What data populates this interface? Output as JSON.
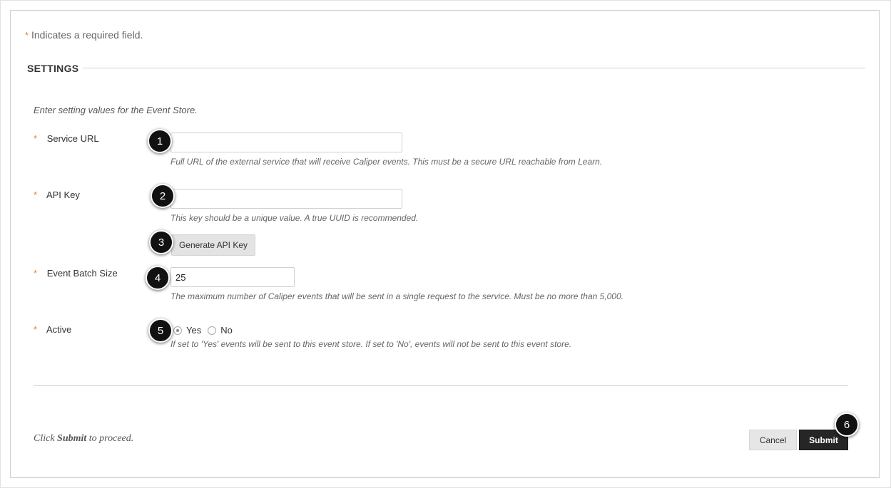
{
  "required_note": {
    "star": "*",
    "text": "Indicates a required field."
  },
  "section": {
    "title": "SETTINGS"
  },
  "instructions": "Enter setting values for the Event Store.",
  "fields": {
    "service_url": {
      "label": "Service URL",
      "value": "",
      "help": "Full URL of the external service that will receive Caliper events. This must be a secure URL reachable from Learn."
    },
    "api_key": {
      "label": "API Key",
      "value": "",
      "help": "This key should be a unique value. A true UUID is recommended.",
      "generate_label": "Generate API Key"
    },
    "batch_size": {
      "label": "Event Batch Size",
      "value": "25",
      "help": "The maximum number of Caliper events that will be sent in a single request to the service. Must be no more than 5,000."
    },
    "active": {
      "label": "Active",
      "options": [
        "Yes",
        "No"
      ],
      "selected": "Yes",
      "help": "If set to 'Yes' events will be sent to this event store. If set to 'No', events will not be sent to this event store."
    }
  },
  "footer": {
    "proceed_prefix": "Click ",
    "proceed_bold": "Submit",
    "proceed_suffix": " to proceed.",
    "cancel_label": "Cancel",
    "submit_label": "Submit"
  },
  "callouts": [
    "1",
    "2",
    "3",
    "4",
    "5",
    "6"
  ],
  "colors": {
    "required_star": "#e8812c",
    "submit_bg": "#262626",
    "callout_bg": "#111111"
  }
}
